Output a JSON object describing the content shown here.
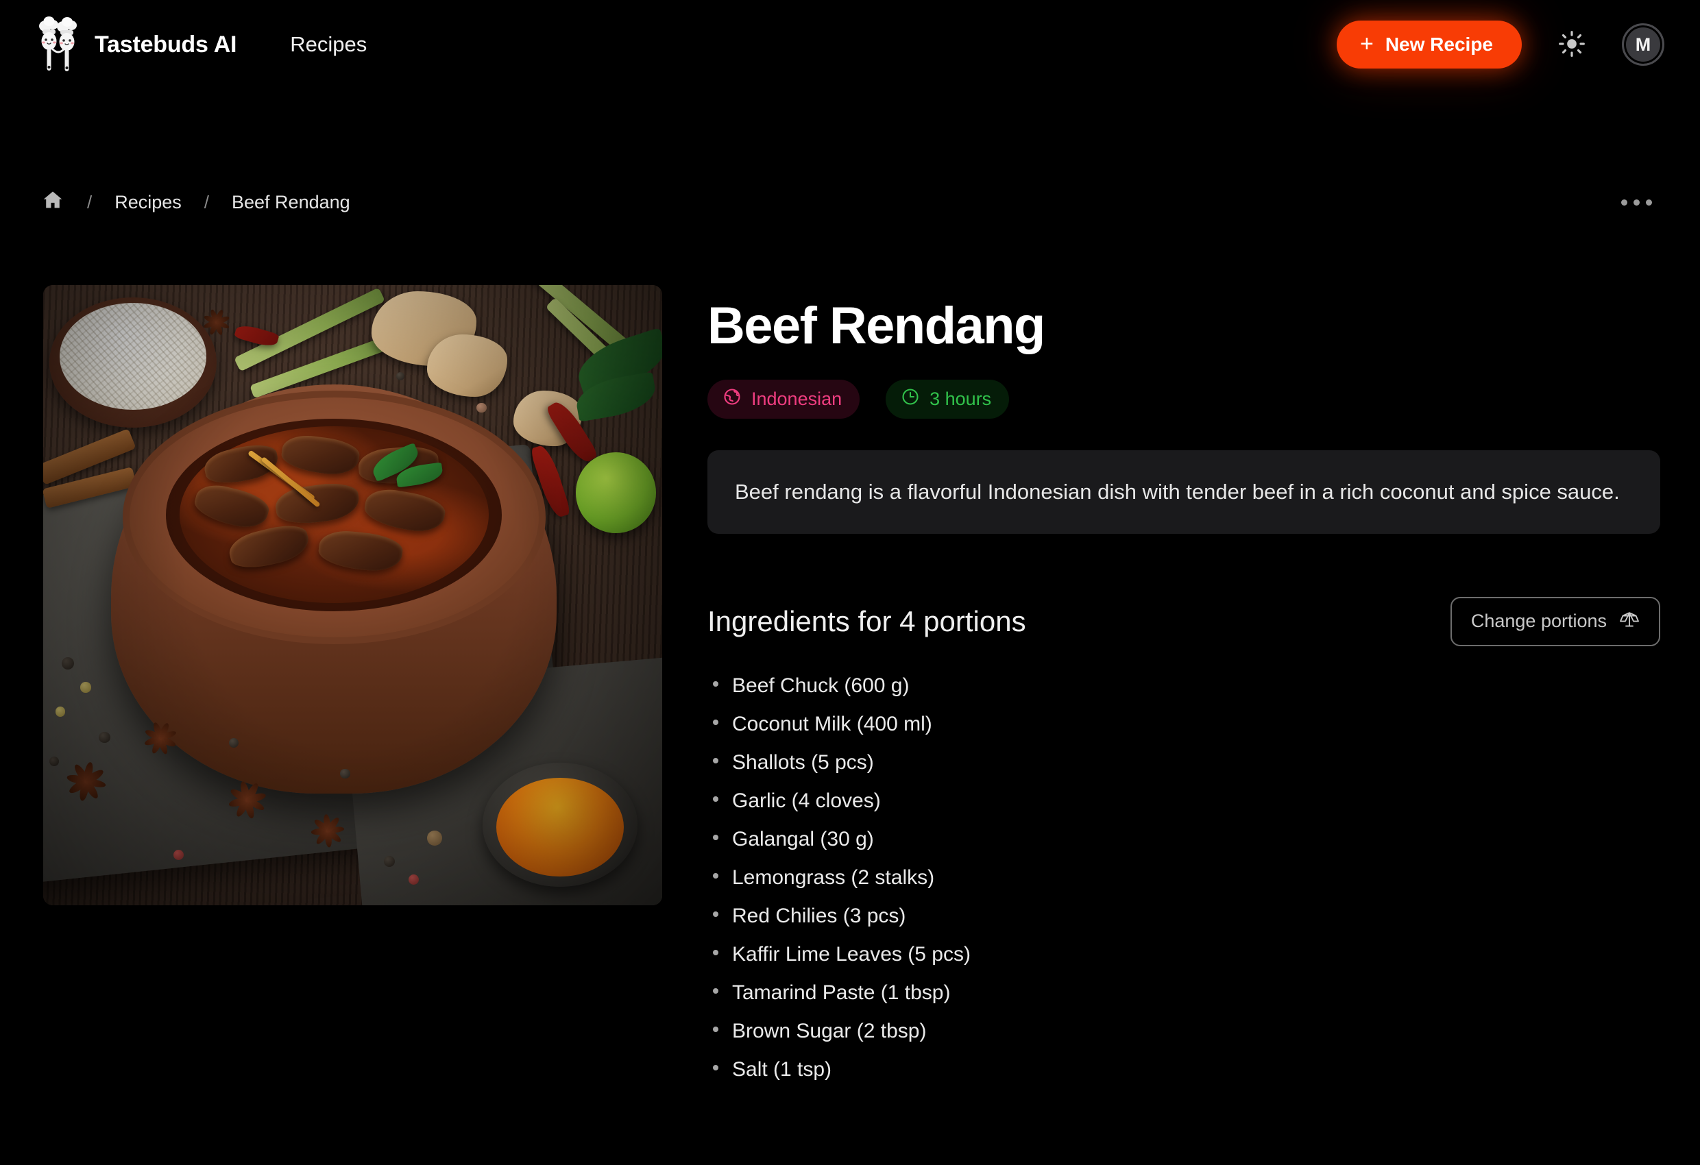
{
  "header": {
    "brand_name": "Tastebuds AI",
    "logo_icon": "chef-utensils-icon",
    "nav": [
      {
        "label": "Recipes"
      }
    ],
    "new_recipe_label": "New Recipe",
    "new_recipe_plus": "+",
    "theme_icon": "sun-icon",
    "avatar_initial": "M",
    "accent_color": "#f83c05"
  },
  "breadcrumb": {
    "home_icon": "home-icon",
    "separator": "/",
    "items": [
      {
        "label": "Recipes"
      },
      {
        "label": "Beef Rendang"
      }
    ],
    "more_icon": "ellipsis-icon"
  },
  "recipe": {
    "image_alt": "Beef rendang in clay bowl with rice, spices, ginger, lemongrass, lime and chilies",
    "title": "Beef Rendang",
    "badges": [
      {
        "icon": "globe-icon",
        "label": "Indonesian",
        "color": "#ef3d80"
      },
      {
        "icon": "clock-icon",
        "label": "3 hours",
        "color": "#31c24b"
      }
    ],
    "description": "Beef rendang is a flavorful Indonesian dish with tender beef in a rich coconut and spice sauce.",
    "ingredients_heading": "Ingredients for 4 portions",
    "portions": 4,
    "change_portions_label": "Change portions",
    "change_portions_icon": "⚖",
    "ingredients": [
      "Beef Chuck (600 g)",
      "Coconut Milk (400 ml)",
      "Shallots (5 pcs)",
      "Garlic (4 cloves)",
      "Galangal (30 g)",
      "Lemongrass (2 stalks)",
      "Red Chilies (3 pcs)",
      "Kaffir Lime Leaves (5 pcs)",
      "Tamarind Paste (1 tbsp)",
      "Brown Sugar (2 tbsp)",
      "Salt (1 tsp)"
    ]
  }
}
